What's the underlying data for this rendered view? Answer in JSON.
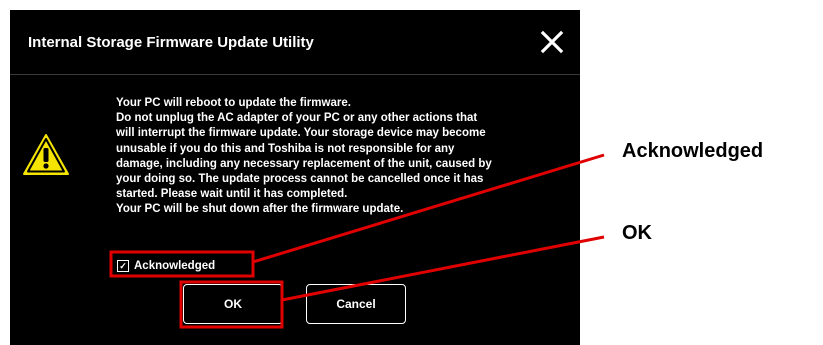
{
  "dialog": {
    "title": "Internal Storage Firmware Update Utility",
    "close_icon": "close-icon",
    "warning_icon": "warning-triangle-icon",
    "message_lines": [
      "Your PC will reboot to update the firmware.",
      "Do not unplug the AC adapter of your PC or any other actions that",
      "will interrupt the firmware update. Your storage  device may become",
      "unusable if you do this and Toshiba is not responsible for any",
      "damage, including any necessary replacement of the unit, caused by",
      "your doing so. The update process cannot be cancelled once it has",
      "started.  Please wait until it has completed.",
      "Your PC will be shut down after the firmware update."
    ],
    "acknowledged": {
      "label": "Acknowledged",
      "checked": true
    },
    "buttons": {
      "ok_label": "OK",
      "cancel_label": "Cancel"
    }
  },
  "annotations": {
    "acknowledged_label": "Acknowledged",
    "ok_label": "OK",
    "highlight_color": "#e00000"
  },
  "colors": {
    "dialog_bg": "#000000",
    "warning_yellow": "#f5e400",
    "text": "#ffffff"
  }
}
